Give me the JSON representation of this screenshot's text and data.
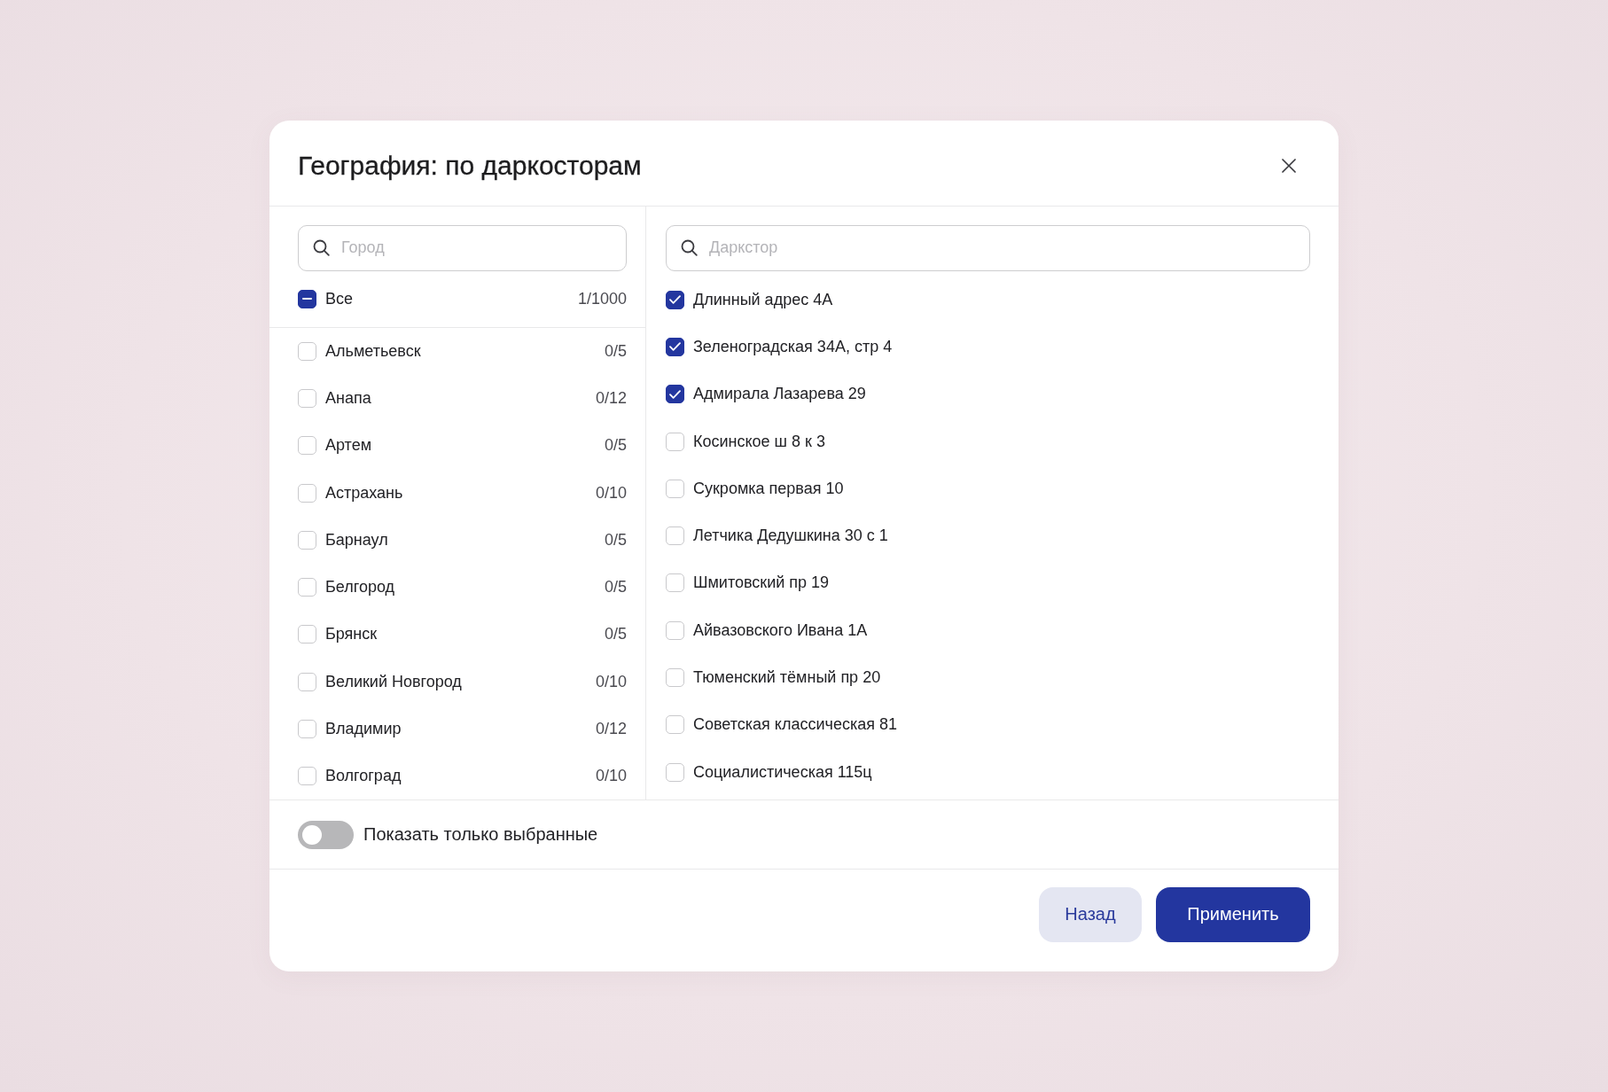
{
  "dialog": {
    "title": "География: по даркосторам"
  },
  "cities": {
    "search": {
      "placeholder": "Город"
    },
    "all": {
      "label": "Все",
      "count": "1/1000",
      "indeterminate": true
    },
    "items": [
      {
        "name": "Альметьевск",
        "count": "0/5",
        "checked": false
      },
      {
        "name": "Анапа",
        "count": "0/12",
        "checked": false
      },
      {
        "name": "Артем",
        "count": "0/5",
        "checked": false
      },
      {
        "name": "Астрахань",
        "count": "0/10",
        "checked": false
      },
      {
        "name": "Барнаул",
        "count": "0/5",
        "checked": false
      },
      {
        "name": "Белгород",
        "count": "0/5",
        "checked": false
      },
      {
        "name": "Брянск",
        "count": "0/5",
        "checked": false
      },
      {
        "name": "Великий Новгород",
        "count": "0/10",
        "checked": false
      },
      {
        "name": "Владимир",
        "count": "0/12",
        "checked": false
      },
      {
        "name": "Волгоград",
        "count": "0/10",
        "checked": false
      }
    ]
  },
  "darkstores": {
    "search": {
      "placeholder": "Даркстор"
    },
    "items": [
      {
        "name": "Длинный адрес 4А",
        "checked": true
      },
      {
        "name": "Зеленоградская 34А, стр 4",
        "checked": true
      },
      {
        "name": "Адмирала Лазарева 29",
        "checked": true
      },
      {
        "name": "Косинское ш 8 к 3",
        "checked": false
      },
      {
        "name": "Сукромка первая 10",
        "checked": false
      },
      {
        "name": "Летчика Дедушкина 30 с 1",
        "checked": false
      },
      {
        "name": "Шмитовский пр 19",
        "checked": false
      },
      {
        "name": "Айвазовского Ивана 1А",
        "checked": false
      },
      {
        "name": "Тюменский тёмный пр 20",
        "checked": false
      },
      {
        "name": "Советская классическая 81",
        "checked": false
      },
      {
        "name": "Социалистическая 115ц",
        "checked": false
      }
    ]
  },
  "show_selected_only": {
    "label": "Показать только выбранные",
    "on": false
  },
  "buttons": [
    {
      "label": "Назад",
      "kind": "secondary"
    },
    {
      "label": "Применить",
      "kind": "primary"
    }
  ]
}
